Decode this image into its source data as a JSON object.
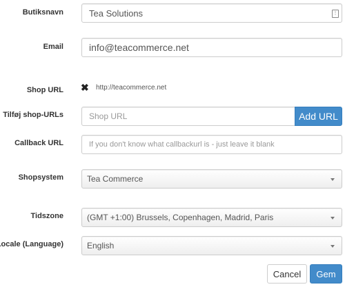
{
  "fields": {
    "shop_name": {
      "label": "Butiksnavn",
      "value": "Tea Solutions"
    },
    "email": {
      "label": "Email",
      "value": "info@teacommerce.net"
    },
    "shop_url": {
      "label": "Shop URL",
      "urls": [
        "http://teacommerce.net"
      ]
    },
    "add_shop_url": {
      "label": "Tilføj shop-URLs",
      "placeholder": "Shop URL",
      "button": "Add URL"
    },
    "callback_url": {
      "label": "Callback URL",
      "placeholder": "If you don't know what callbackurl is - just leave it blank"
    },
    "shop_system": {
      "label": "Shopsystem",
      "value": "Tea Commerce"
    },
    "timezone": {
      "label": "Tidszone",
      "value": "(GMT +1:00) Brussels, Copenhagen, Madrid, Paris"
    },
    "locale": {
      "label": "Locale (Language)",
      "value": "English"
    }
  },
  "actions": {
    "cancel": "Cancel",
    "save": "Gem"
  },
  "colors": {
    "primary": "#428bca"
  }
}
